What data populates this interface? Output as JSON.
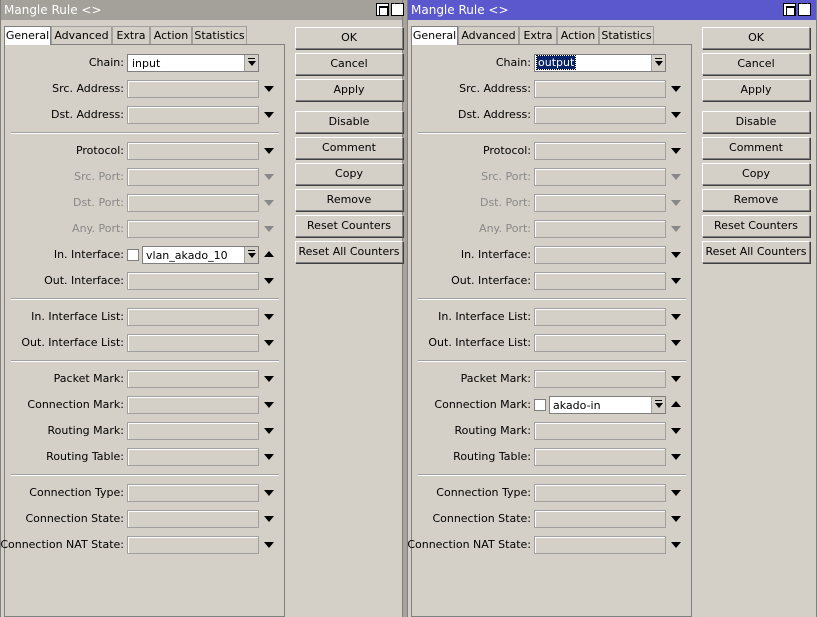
{
  "windows": [
    {
      "title": "Mangle Rule <>",
      "tabs": [
        "General",
        "Advanced",
        "Extra",
        "Action",
        "Statistics"
      ],
      "fields": {
        "chain": {
          "label": "Chain:",
          "value": "input"
        },
        "src_address": {
          "label": "Src. Address:"
        },
        "dst_address": {
          "label": "Dst. Address:"
        },
        "protocol": {
          "label": "Protocol:"
        },
        "src_port": {
          "label": "Src. Port:"
        },
        "dst_port": {
          "label": "Dst. Port:"
        },
        "any_port": {
          "label": "Any. Port:"
        },
        "in_interface": {
          "label": "In. Interface:",
          "value": "vlan_akado_10"
        },
        "out_interface": {
          "label": "Out. Interface:"
        },
        "in_interface_list": {
          "label": "In. Interface List:"
        },
        "out_interface_list": {
          "label": "Out. Interface List:"
        },
        "packet_mark": {
          "label": "Packet Mark:"
        },
        "connection_mark": {
          "label": "Connection Mark:"
        },
        "routing_mark": {
          "label": "Routing Mark:"
        },
        "routing_table": {
          "label": "Routing Table:"
        },
        "connection_type": {
          "label": "Connection Type:"
        },
        "connection_state": {
          "label": "Connection State:"
        },
        "connection_nat_state": {
          "label": "Connection NAT State:"
        }
      },
      "buttons": [
        "OK",
        "Cancel",
        "Apply",
        "Disable",
        "Comment",
        "Copy",
        "Remove",
        "Reset Counters",
        "Reset All Counters"
      ]
    },
    {
      "title": "Mangle Rule <>",
      "tabs": [
        "General",
        "Advanced",
        "Extra",
        "Action",
        "Statistics"
      ],
      "fields": {
        "chain": {
          "label": "Chain:",
          "value": "output"
        },
        "src_address": {
          "label": "Src. Address:"
        },
        "dst_address": {
          "label": "Dst. Address:"
        },
        "protocol": {
          "label": "Protocol:"
        },
        "src_port": {
          "label": "Src. Port:"
        },
        "dst_port": {
          "label": "Dst. Port:"
        },
        "any_port": {
          "label": "Any. Port:"
        },
        "in_interface": {
          "label": "In. Interface:"
        },
        "out_interface": {
          "label": "Out. Interface:"
        },
        "in_interface_list": {
          "label": "In. Interface List:"
        },
        "out_interface_list": {
          "label": "Out. Interface List:"
        },
        "packet_mark": {
          "label": "Packet Mark:"
        },
        "connection_mark": {
          "label": "Connection Mark:",
          "value": "akado-in"
        },
        "routing_mark": {
          "label": "Routing Mark:"
        },
        "routing_table": {
          "label": "Routing Table:"
        },
        "connection_type": {
          "label": "Connection Type:"
        },
        "connection_state": {
          "label": "Connection State:"
        },
        "connection_nat_state": {
          "label": "Connection NAT State:"
        }
      },
      "buttons": [
        "OK",
        "Cancel",
        "Apply",
        "Disable",
        "Comment",
        "Copy",
        "Remove",
        "Reset Counters",
        "Reset All Counters"
      ]
    }
  ]
}
